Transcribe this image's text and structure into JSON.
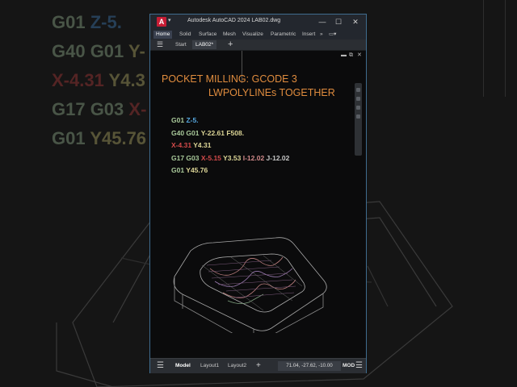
{
  "background": {
    "code_lines": [
      {
        "parts": [
          {
            "t": "G01 ",
            "c": "g"
          },
          {
            "t": "Z-5.",
            "c": "b"
          }
        ]
      },
      {
        "parts": [
          {
            "t": "G40 G01 ",
            "c": "g"
          },
          {
            "t": "Y-",
            "c": "y"
          }
        ]
      },
      {
        "parts": [
          {
            "t": "X-4.31 ",
            "c": "r"
          },
          {
            "t": "Y4.3",
            "c": "y"
          }
        ]
      },
      {
        "parts": [
          {
            "t": "G17 G03 ",
            "c": "g"
          },
          {
            "t": "X-",
            "c": "r"
          }
        ]
      },
      {
        "parts": [
          {
            "t": "G01 ",
            "c": "g"
          },
          {
            "t": "Y45.76",
            "c": "y"
          }
        ]
      }
    ]
  },
  "window": {
    "app_icon": "A",
    "title": "Autodesk AutoCAD 2024    LAB02.dwg",
    "controls": {
      "minimize": "—",
      "maximize": "☐",
      "close": "✕"
    }
  },
  "ribbon": {
    "tabs": [
      "Home",
      "Solid",
      "Surface",
      "Mesh",
      "Visualize",
      "Parametric",
      "Insert"
    ],
    "active": "Home",
    "more": "»",
    "extra": "▭▾"
  },
  "doc_tabs": {
    "menu_icon": "☰",
    "tabs": [
      {
        "label": "Start"
      },
      {
        "label": "LAB02*"
      }
    ],
    "active": "LAB02*",
    "add": "+"
  },
  "viewport": {
    "controls": [
      "▬",
      "⧉",
      "✕"
    ],
    "heading_line1": "POCKET MILLING: GCODE 3",
    "heading_line2": "LWPOLYLINEs TOGETHER",
    "code_lines": [
      [
        {
          "t": "G01 ",
          "c": "cg"
        },
        {
          "t": "Z-5.",
          "c": "cb"
        }
      ],
      [
        {
          "t": "G40 G01 ",
          "c": "cg"
        },
        {
          "t": "Y-22.61 F508.",
          "c": "cy"
        }
      ],
      [
        {
          "t": "X-4.31 ",
          "c": "cr"
        },
        {
          "t": "Y4.31",
          "c": "cy"
        }
      ],
      [
        {
          "t": "G17 G03 ",
          "c": "cg"
        },
        {
          "t": "X-5.15 ",
          "c": "cr"
        },
        {
          "t": "Y3.53 ",
          "c": "cy"
        },
        {
          "t": "I-12.02 ",
          "c": "cp"
        },
        {
          "t": "J-12.02",
          "c": "cn"
        }
      ],
      [
        {
          "t": "G01 ",
          "c": "cg"
        },
        {
          "t": "Y45.76",
          "c": "cy"
        }
      ]
    ]
  },
  "status_bar": {
    "menu_icon": "☰",
    "tabs": [
      "Model",
      "Layout1",
      "Layout2"
    ],
    "active": "Model",
    "add": "+",
    "coordinates": "71.04, -27.62, -10.00",
    "mode": "MOD",
    "settings_icon": "☰"
  },
  "colors": {
    "heading": "#e08c3e",
    "window_border": "#3f6c8e",
    "app_icon": "#c71d35"
  }
}
